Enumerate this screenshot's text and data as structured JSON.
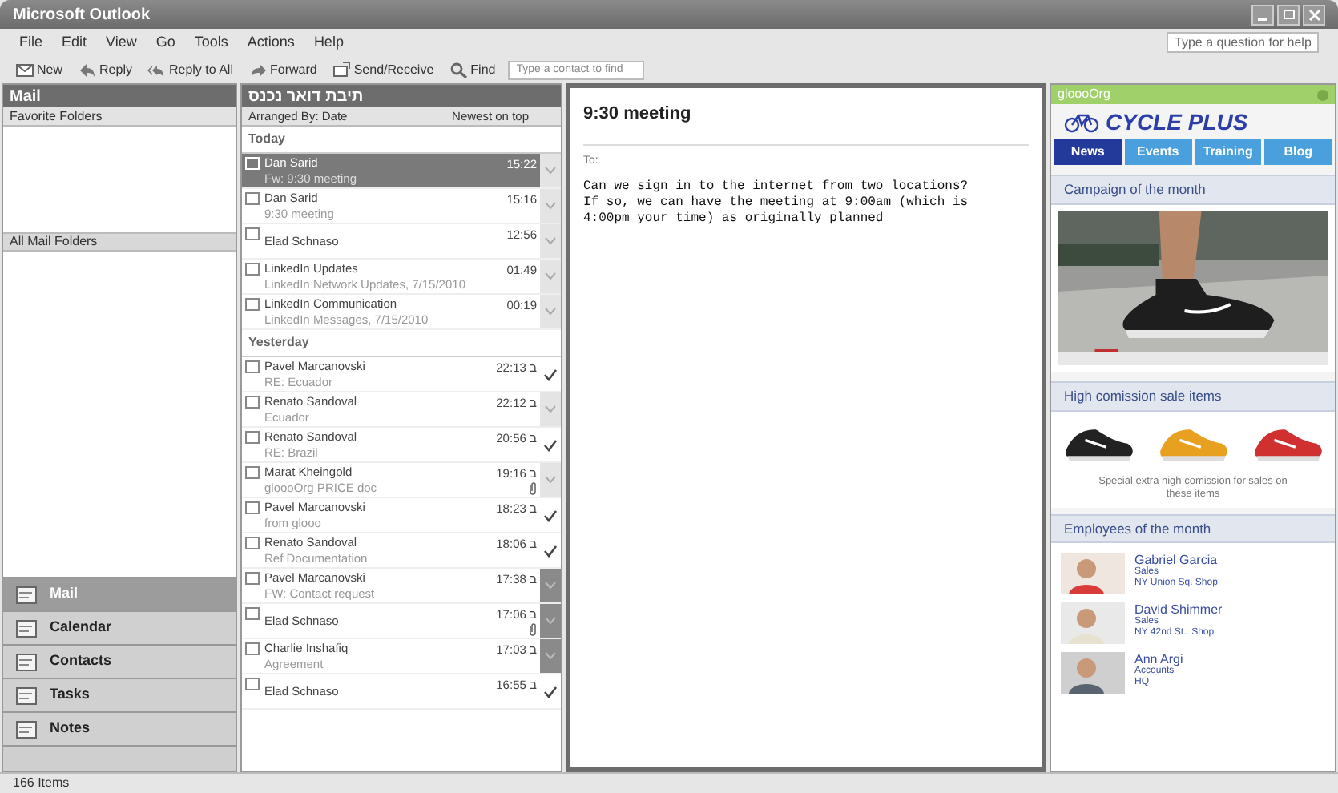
{
  "window": {
    "title": "Microsoft Outlook"
  },
  "menu": [
    "File",
    "Edit",
    "View",
    "Go",
    "Tools",
    "Actions",
    "Help"
  ],
  "help_box": {
    "placeholder": "Type a question for help"
  },
  "toolbar": {
    "buttons": [
      {
        "label": "New",
        "kind": "new"
      },
      {
        "label": "Reply",
        "kind": "reply"
      },
      {
        "label": "Reply to All",
        "kind": "replyall"
      },
      {
        "label": "Forward",
        "kind": "forward"
      },
      {
        "label": "Send/Receive",
        "kind": "send"
      },
      {
        "label": "Find",
        "kind": "find"
      }
    ],
    "contact_search": {
      "placeholder": "Type a contact to find"
    }
  },
  "nav": {
    "title": "Mail",
    "favorite_folders": "Favorite Folders",
    "all_folders": "All Mail Folders",
    "buttons": [
      {
        "label": "Mail",
        "selected": true
      },
      {
        "label": "Calendar",
        "selected": false
      },
      {
        "label": "Contacts",
        "selected": false
      },
      {
        "label": "Tasks",
        "selected": false
      },
      {
        "label": "Notes",
        "selected": false
      }
    ]
  },
  "message_list": {
    "title": "תיבת דואר נכנס",
    "arranged_by": "Arranged By: Date",
    "sort": "Newest on top",
    "groups": [
      {
        "label": "Today",
        "messages": [
          {
            "sender": "Dan Sarid",
            "subject": "Fw: 9:30 meeting",
            "time": "15:22",
            "selected": true,
            "completed": false,
            "flagged": false,
            "attachment": false
          },
          {
            "sender": "Dan Sarid",
            "subject": "9:30 meeting",
            "time": "15:16",
            "selected": false,
            "completed": false,
            "flagged": false,
            "attachment": false
          },
          {
            "sender": "Elad Schnaso",
            "time": "12:56",
            "selected": false,
            "completed": false,
            "flagged": false,
            "attachment": false
          },
          {
            "sender": "LinkedIn Updates",
            "subject": "LinkedIn Network Updates, 7/15/2010",
            "time": "01:49",
            "selected": false,
            "completed": false,
            "flagged": false,
            "attachment": false
          },
          {
            "sender": "LinkedIn Communication",
            "subject": "LinkedIn Messages, 7/15/2010",
            "time": "00:19",
            "selected": false,
            "completed": false,
            "flagged": false,
            "attachment": false
          }
        ]
      },
      {
        "label": "Yesterday",
        "messages": [
          {
            "sender": "Pavel Marcanovski",
            "subject": "RE: Ecuador",
            "time": "ב 22:13",
            "selected": false,
            "completed": true,
            "flagged": false,
            "attachment": false
          },
          {
            "sender": "Renato Sandoval",
            "subject": "Ecuador",
            "time": "ב 22:12",
            "selected": false,
            "completed": false,
            "flagged": false,
            "attachment": false
          },
          {
            "sender": "Renato Sandoval",
            "subject": "RE: Brazil",
            "time": "ב 20:56",
            "selected": false,
            "completed": true,
            "flagged": false,
            "attachment": false
          },
          {
            "sender": "Marat Kheingold",
            "subject": "gloooOrg PRICE doc",
            "time": "ב 19:16",
            "selected": false,
            "completed": false,
            "flagged": false,
            "attachment": true
          },
          {
            "sender": "Pavel Marcanovski",
            "subject": "from glooo",
            "time": "ב 18:23",
            "selected": false,
            "completed": true,
            "flagged": false,
            "attachment": false
          },
          {
            "sender": "Renato Sandoval",
            "subject": "Ref Documentation",
            "time": "ב 18:06",
            "selected": false,
            "completed": true,
            "flagged": false,
            "attachment": false
          },
          {
            "sender": "Pavel Marcanovski",
            "subject": "FW: Contact request",
            "time": "ב 17:38",
            "selected": false,
            "completed": false,
            "flagged": true,
            "attachment": false
          },
          {
            "sender": "Elad Schnaso",
            "time": "ב 17:06",
            "selected": false,
            "completed": false,
            "flagged": true,
            "attachment": true
          },
          {
            "sender": "Charlie Inshafiq",
            "subject": "Agreement",
            "time": "ב 17:03",
            "selected": false,
            "completed": false,
            "flagged": true,
            "attachment": false
          },
          {
            "sender": "Elad Schnaso",
            "time": "ב 16:55",
            "selected": false,
            "completed": true,
            "flagged": false,
            "attachment": false
          }
        ]
      }
    ]
  },
  "reading_pane": {
    "subject": "9:30 meeting",
    "to_label": "To:",
    "body": "Can we sign in to the internet from two locations?\nIf so, we can have the meeting at 9:00am (which is\n4:00pm your time) as originally planned"
  },
  "sidebar": {
    "header": "gloooOrg",
    "brand": "CYCLE PLUS",
    "tabs": [
      {
        "label": "News",
        "selected": true
      },
      {
        "label": "Events",
        "selected": false
      },
      {
        "label": "Training",
        "selected": false
      },
      {
        "label": "Blog",
        "selected": false
      }
    ],
    "campaign": {
      "title": "Campaign of the month"
    },
    "sale": {
      "title": "High comission sale items",
      "caption": "Special extra high comission for sales on these items"
    },
    "employees": {
      "title": "Employees of the month",
      "people": [
        {
          "name": "Gabriel Garcia",
          "dept": "Sales",
          "location": "NY Union Sq. Shop"
        },
        {
          "name": "David Shimmer",
          "dept": "Sales",
          "location": "NY 42nd St.. Shop"
        },
        {
          "name": "Ann Argi",
          "dept": "Accounts",
          "location": "HQ"
        }
      ]
    }
  },
  "status_bar": {
    "items": "166 Items"
  }
}
